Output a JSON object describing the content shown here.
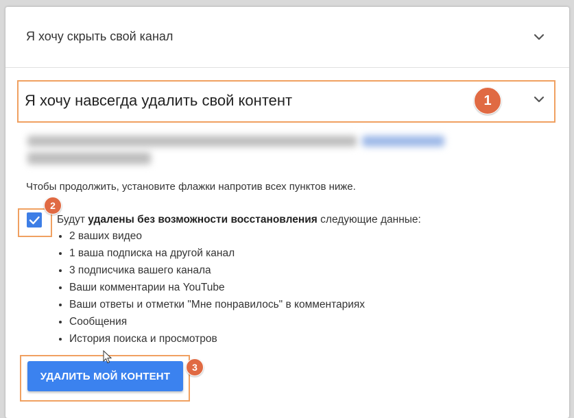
{
  "sections": {
    "hide_channel": {
      "title": "Я хочу скрыть свой канал"
    },
    "delete_content": {
      "title": "Я хочу навсегда удалить свой контент"
    }
  },
  "annotations": {
    "badge1": "1",
    "badge2": "2",
    "badge3": "3"
  },
  "instruction": "Чтобы продолжить, установите флажки напротив всех пунктов ниже.",
  "confirm": {
    "checked": true,
    "intro_prefix": "Будут ",
    "intro_bold": "удалены без возможности восстановления",
    "intro_suffix": " следующие данные:",
    "items": [
      "2 ваших видео",
      "1 ваша подписка на другой канал",
      "3 подписчика вашего канала",
      "Ваши комментарии на YouTube",
      "Ваши ответы и отметки \"Мне понравилось\" в комментариях",
      "Сообщения",
      "История поиска и просмотров"
    ]
  },
  "delete_button": {
    "label": "УДАЛИТЬ МОЙ КОНТЕНТ"
  },
  "colors": {
    "accent": "#3b82ef",
    "highlight": "#f0a060",
    "badge": "#e06a43"
  }
}
